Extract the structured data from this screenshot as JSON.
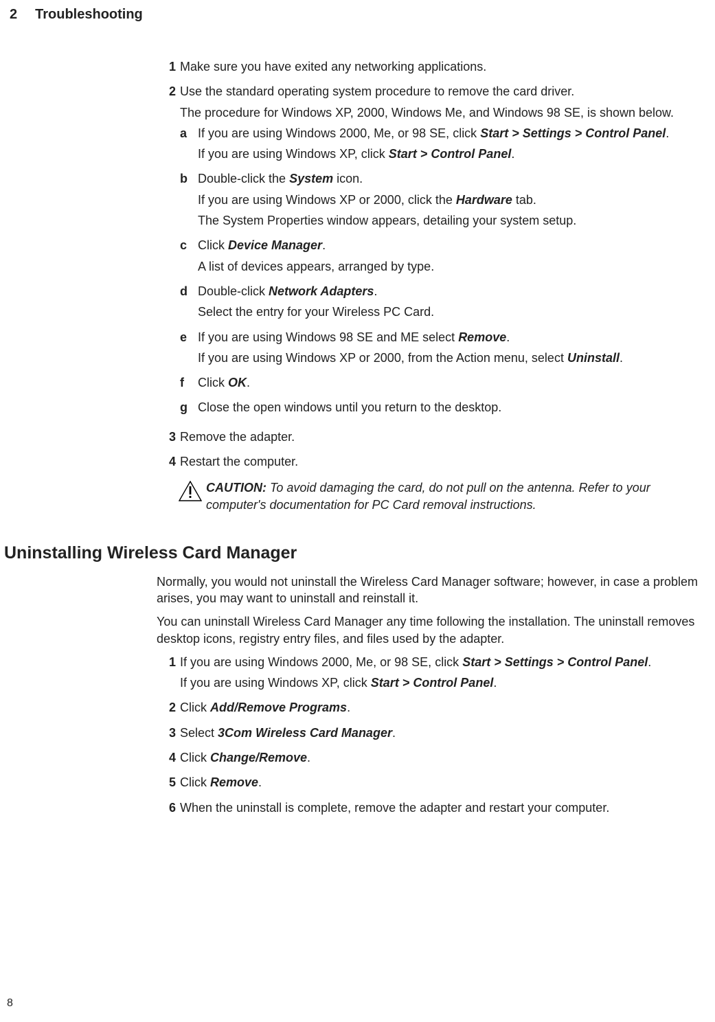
{
  "header": {
    "chapter_number": "2",
    "chapter_title": "Troubleshooting"
  },
  "page_number": "8",
  "steps_top": {
    "s1": "Make sure you have exited any networking applications.",
    "s2_line1": "Use the standard operating system procedure to remove the card driver.",
    "s2_line2": "The procedure for Windows XP, 2000, Windows Me, and Windows 98 SE, is shown below.",
    "a_pre": "If you are using Windows 2000, Me, or 98 SE, click ",
    "a_em": "Start > Settings > Control Panel",
    "a_post": ".",
    "a2_pre": "If you are using Windows XP, click ",
    "a2_em": "Start > Control Panel",
    "a2_post": ".",
    "b_pre": "Double-click the ",
    "b_em": "System",
    "b_post": " icon.",
    "b2_pre": "If you are using Windows XP or 2000, click the ",
    "b2_em": "Hardware",
    "b2_post": " tab.",
    "b3": "The System Properties window appears, detailing your system setup.",
    "c_pre": "Click ",
    "c_em": "Device Manager",
    "c_post": ".",
    "c2": "A list of devices appears, arranged by type.",
    "d_pre": "Double-click ",
    "d_em": "Network Adapters",
    "d_post": ".",
    "d2": "Select the entry for your Wireless PC Card.",
    "e_pre": "If you are using Windows 98 SE and ME select ",
    "e_em": "Remove",
    "e_post": ".",
    "e2_pre": "If you are using Windows XP or 2000, from the Action menu, select ",
    "e2_em": "Uninstall",
    "e2_post": ".",
    "f_pre": "Click ",
    "f_em": "OK",
    "f_post": ".",
    "g": "Close the open windows until you return to the desktop.",
    "s3": "Remove the adapter.",
    "s4": "Restart the computer."
  },
  "caution": {
    "label": "CAUTION:",
    "text": " To avoid damaging the card, do not pull on the antenna. Refer to your computer's documentation for PC Card removal instructions."
  },
  "section2": {
    "title": "Uninstalling Wireless Card Manager",
    "lead1": "Normally, you would not uninstall the Wireless Card Manager software; however, in case a problem arises, you may want to uninstall and reinstall it.",
    "lead2": "You can uninstall Wireless Card Manager any time following the installation. The uninstall removes desktop icons, registry entry files, and files used by the adapter.",
    "s1_pre": "If you are using Windows 2000, Me, or 98 SE, click ",
    "s1_em": "Start > Settings > Control Panel",
    "s1_post": ".",
    "s1b_pre": "If you are using Windows XP, click ",
    "s1b_em": "Start > Control Panel",
    "s1b_post": ".",
    "s2_pre": "Click ",
    "s2_em": "Add/Remove Programs",
    "s2_post": ".",
    "s3_pre": "Select ",
    "s3_em": "3Com Wireless Card Manager",
    "s3_post": ".",
    "s4_pre": "Click ",
    "s4_em": "Change/Remove",
    "s4_post": ".",
    "s5_pre": "Click ",
    "s5_em": "Remove",
    "s5_post": ".",
    "s6": "When the uninstall is complete, remove the adapter and restart your computer."
  },
  "markers": {
    "n1": "1",
    "n2": "2",
    "n3": "3",
    "n4": "4",
    "n5": "5",
    "n6": "6",
    "a": "a",
    "b": "b",
    "c": "c",
    "d": "d",
    "e": "e",
    "f": "f",
    "g": "g"
  }
}
